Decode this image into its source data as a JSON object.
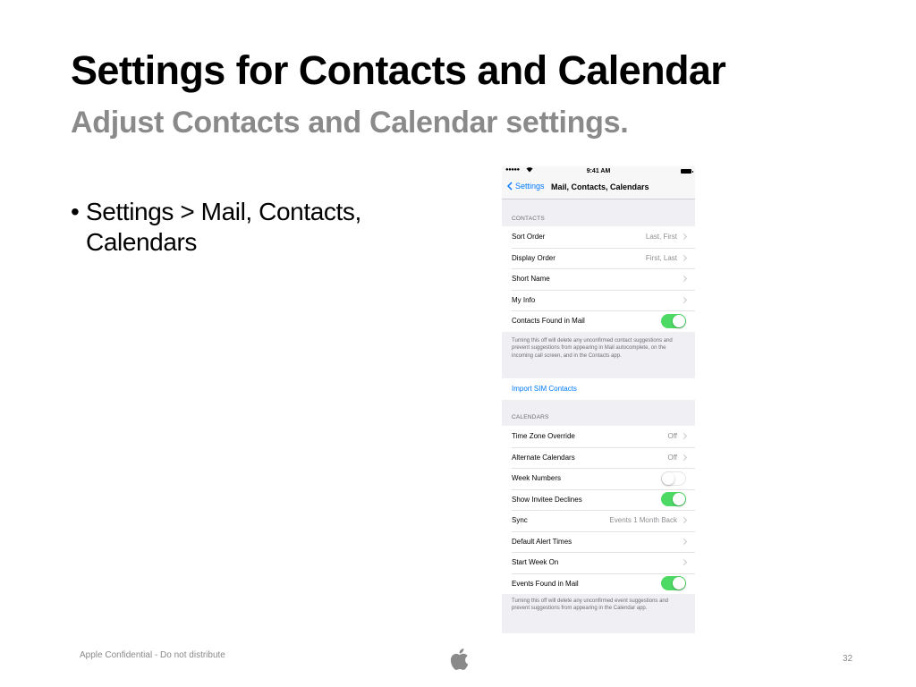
{
  "slide": {
    "title": "Settings for Contacts and Calendar",
    "subtitle": "Adjust Contacts and Calendar settings.",
    "bullet": "Settings > Mail, Contacts, Calendars",
    "footer": "Apple Confidential - Do not distribute",
    "page_number": "32",
    "logo_icon": "apple-logo-icon"
  },
  "phone": {
    "status": {
      "signal": "●●●●●",
      "time": "9:41 AM"
    },
    "nav": {
      "back_label": "Settings",
      "title": "Mail, Contacts, Calendars"
    },
    "contacts": {
      "header": "CONTACTS",
      "sort_order": {
        "label": "Sort Order",
        "value": "Last, First"
      },
      "display_order": {
        "label": "Display Order",
        "value": "First, Last"
      },
      "short_name": {
        "label": "Short Name"
      },
      "my_info": {
        "label": "My Info"
      },
      "found_in_mail": {
        "label": "Contacts Found in Mail",
        "on": true
      },
      "footnote": "Turning this off will delete any unconfirmed contact suggestions and prevent suggestions from appearing in Mail autocomplete, on the incoming call screen, and in the Contacts app."
    },
    "import_sim": {
      "label": "Import SIM Contacts"
    },
    "calendars": {
      "header": "CALENDARS",
      "time_zone_override": {
        "label": "Time Zone Override",
        "value": "Off"
      },
      "alternate_calendars": {
        "label": "Alternate Calendars",
        "value": "Off"
      },
      "week_numbers": {
        "label": "Week Numbers",
        "on": false
      },
      "show_invitee_declines": {
        "label": "Show Invitee Declines",
        "on": true
      },
      "sync": {
        "label": "Sync",
        "value": "Events 1 Month Back"
      },
      "default_alert_times": {
        "label": "Default Alert Times"
      },
      "start_week_on": {
        "label": "Start Week On"
      },
      "events_found_in_mail": {
        "label": "Events Found in Mail",
        "on": true
      },
      "footnote": "Turning this off will delete any unconfirmed event suggestions and prevent suggestions from appearing in the Calendar app."
    },
    "colors": {
      "tint": "#007aff",
      "toggle_on": "#4cd964",
      "grouped_background": "#efeff4"
    }
  }
}
